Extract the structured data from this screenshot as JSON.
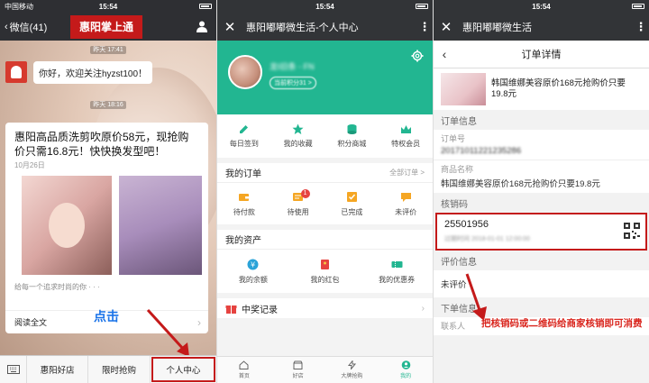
{
  "panel1": {
    "status": {
      "carrier": "中国移动",
      "time": "15:54",
      "battery": ""
    },
    "header": {
      "back_label": "微信(41)",
      "title": "惠阳掌上通"
    },
    "timestamps": [
      "昨天 17:41",
      "昨天 18:16"
    ],
    "welcome_message": "你好，欢迎关注hyzst100！",
    "article": {
      "title": "惠阳高品质洗剪吹原价58元，现抢购价只需16.8元！快快换发型吧！",
      "date": "10月26日",
      "desc": "给每一个追求时尚的你 · · ·",
      "read_all": "阅读全文"
    },
    "click_hint": "点击",
    "bottom_menu": [
      "惠阳好店",
      "限时抢购",
      "个人中心"
    ]
  },
  "panel2": {
    "status": {
      "time": "15:54"
    },
    "header": {
      "title": "惠阳嘟嘟微生活-个人中心"
    },
    "profile": {
      "name": "龙Ⅰ旧条 - FN",
      "points": "当前积分31 >"
    },
    "menu": [
      {
        "label": "每日签到",
        "icon": "edit-icon"
      },
      {
        "label": "我的收藏",
        "icon": "star-icon"
      },
      {
        "label": "积分商城",
        "icon": "coins-icon"
      },
      {
        "label": "特权会员",
        "icon": "crown-icon"
      }
    ],
    "orders": {
      "title": "我的订单",
      "more": "全部订单 >",
      "items": [
        {
          "label": "待付款",
          "icon": "wallet-icon",
          "badge": ""
        },
        {
          "label": "待使用",
          "icon": "ticket-icon",
          "badge": "1"
        },
        {
          "label": "已完成",
          "icon": "check-icon",
          "badge": ""
        },
        {
          "label": "未评价",
          "icon": "comment-icon",
          "badge": ""
        }
      ]
    },
    "assets": {
      "title": "我的资产",
      "items": [
        {
          "label": "我的余额",
          "icon": "yen-icon"
        },
        {
          "label": "我的红包",
          "icon": "red-packet-icon"
        },
        {
          "label": "我的优惠券",
          "icon": "coupon-icon"
        }
      ]
    },
    "prize": {
      "label": "中奖记录"
    },
    "tabs": [
      {
        "label": "首页",
        "icon": "home-icon"
      },
      {
        "label": "好店",
        "icon": "shop-icon"
      },
      {
        "label": "大牌抢购",
        "icon": "flash-icon"
      },
      {
        "label": "我的",
        "icon": "user-icon"
      }
    ]
  },
  "panel3": {
    "status": {
      "time": "15:54"
    },
    "header": {
      "title": "惠阳嘟嘟微生活"
    },
    "subheader": {
      "title": "订单详情"
    },
    "product": {
      "title": "韩国维娜美容原价168元抢购价只要19.8元"
    },
    "order_info": {
      "section": "订单信息",
      "order_no_label": "订单号",
      "order_no": "20171011221235286",
      "product_label": "商品名称",
      "product_name": "韩国维娜美容原价168元抢购价只要19.8元"
    },
    "verify": {
      "section": "核销码",
      "code": "25501956",
      "expiry": "过期时间 2018-01-01 12:00:00"
    },
    "review": {
      "section": "评价信息",
      "status": "未评价"
    },
    "buyer": {
      "section": "下单信息",
      "contact_label": "联系人"
    },
    "annotation": "把核销码或二维码给商家核销即可消费"
  },
  "colors": {
    "green": "#22b691",
    "red": "#c41a1a",
    "wechat_dark": "#323437"
  }
}
